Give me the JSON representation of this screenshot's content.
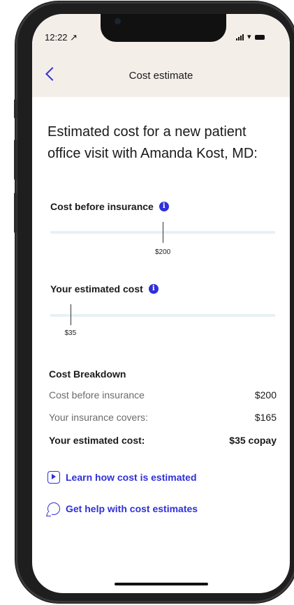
{
  "status_bar": {
    "time": "12:22 ↗"
  },
  "header": {
    "title": "Cost estimate"
  },
  "heading": "Estimated cost for a new patient office visit with Amanda Kost, MD:",
  "cost_before": {
    "label": "Cost before insurance",
    "value_label": "$200",
    "level": 0.5
  },
  "estimated": {
    "label": "Your estimated cost",
    "value_label": "$35",
    "level": 0.09
  },
  "breakdown": {
    "title": "Cost Breakdown",
    "rows": [
      {
        "label": "Cost before insurance",
        "value": "$200"
      },
      {
        "label": "Your insurance covers:",
        "value": "$165"
      },
      {
        "label": "Your estimated cost:",
        "value": "$35 copay"
      }
    ]
  },
  "links": {
    "learn": "Learn how cost is estimated",
    "help": "Get help with cost estimates"
  },
  "colors": {
    "accent": "#2f30d9",
    "header_bg": "#f4eee9",
    "track": "#e7f1f4"
  }
}
